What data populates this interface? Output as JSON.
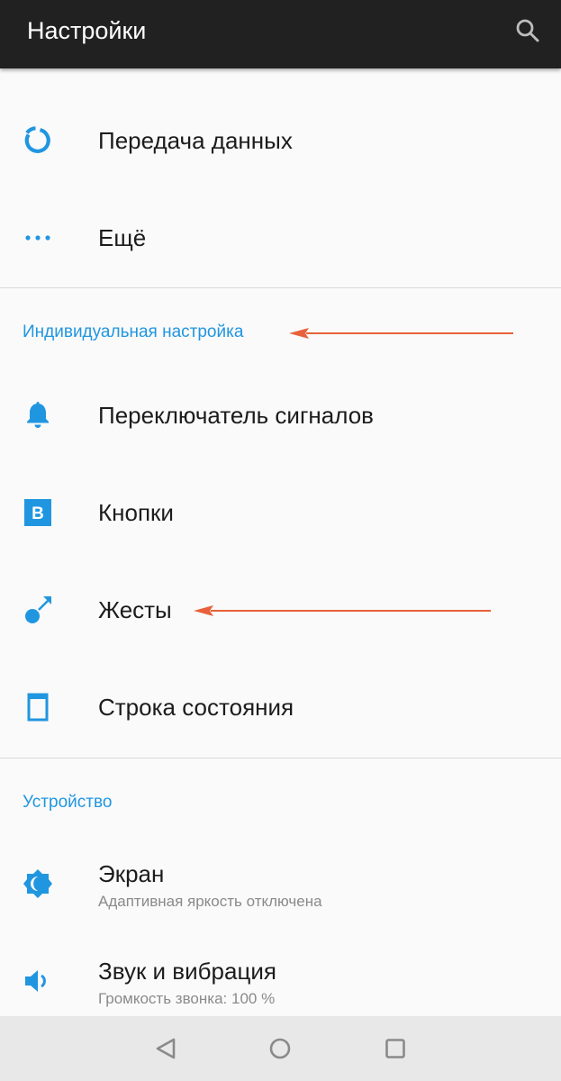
{
  "appbar": {
    "title": "Настройки",
    "search_icon": "search-icon"
  },
  "items": [
    {
      "id": "data",
      "title": "Передача данных",
      "icon": "data-usage-icon"
    },
    {
      "id": "more",
      "title": "Ещё",
      "icon": "more-horiz-icon"
    }
  ],
  "sections": [
    {
      "header": "Индивидуальная настройка",
      "items": [
        {
          "id": "alert-slider",
          "title": "Переключатель сигналов",
          "icon": "bell-icon"
        },
        {
          "id": "buttons",
          "title": "Кнопки",
          "icon": "buttons-icon"
        },
        {
          "id": "gestures",
          "title": "Жесты",
          "icon": "gesture-icon"
        },
        {
          "id": "status-bar",
          "title": "Строка состояния",
          "icon": "status-bar-icon"
        }
      ]
    },
    {
      "header": "Устройство",
      "items": [
        {
          "id": "display",
          "title": "Экран",
          "subtitle": "Адаптивная яркость отключена",
          "icon": "brightness-icon"
        },
        {
          "id": "sound",
          "title": "Звук и вибрация",
          "subtitle": "Громкость звонка: 100 %",
          "icon": "volume-icon"
        }
      ]
    }
  ],
  "navbar": {
    "back_icon": "back-triangle-icon",
    "home_icon": "home-circle-icon",
    "recents_icon": "recents-square-icon"
  },
  "colors": {
    "accent": "#2196e0",
    "appbar": "#212121",
    "background": "#fafafa",
    "annotation_arrow": "#e8613a"
  }
}
